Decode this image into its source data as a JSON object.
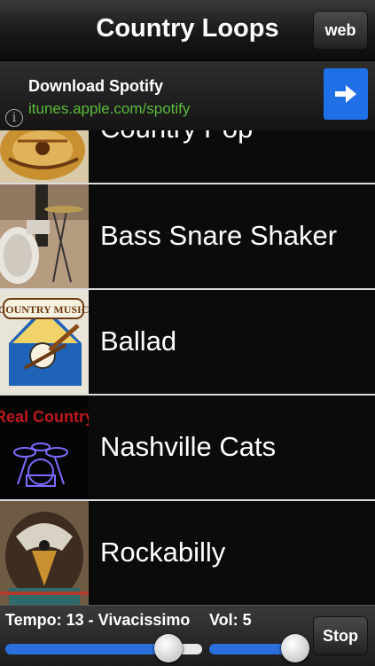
{
  "header": {
    "title": "Country Loops",
    "web_label": "web"
  },
  "ad": {
    "title": "Download Spotify",
    "url": "itunes.apple.com/spotify",
    "info_glyph": "i",
    "arrow_icon": "arrow-right-icon"
  },
  "loops": [
    {
      "label": "Country Pop",
      "thumbnail": "guitar-thumbnail"
    },
    {
      "label": "Bass Snare Shaker",
      "thumbnail": "drum-kit-thumbnail"
    },
    {
      "label": "Ballad",
      "thumbnail": "country-music-logo-thumbnail"
    },
    {
      "label": "Nashville Cats",
      "thumbnail": "real-country-drums-thumbnail"
    },
    {
      "label": "Rockabilly",
      "thumbnail": "eagle-guitar-thumbnail"
    }
  ],
  "controls": {
    "tempo_text": "Tempo: 13 - Vivacissimo",
    "volume_text": "Vol: 5",
    "stop_label": "Stop",
    "tempo_level": 0.83,
    "volume_level": 0.9
  },
  "colors": {
    "accent_blue": "#2a6fdb",
    "ad_url_green": "#5dbb3a",
    "ad_button_blue": "#1f6fe6"
  }
}
